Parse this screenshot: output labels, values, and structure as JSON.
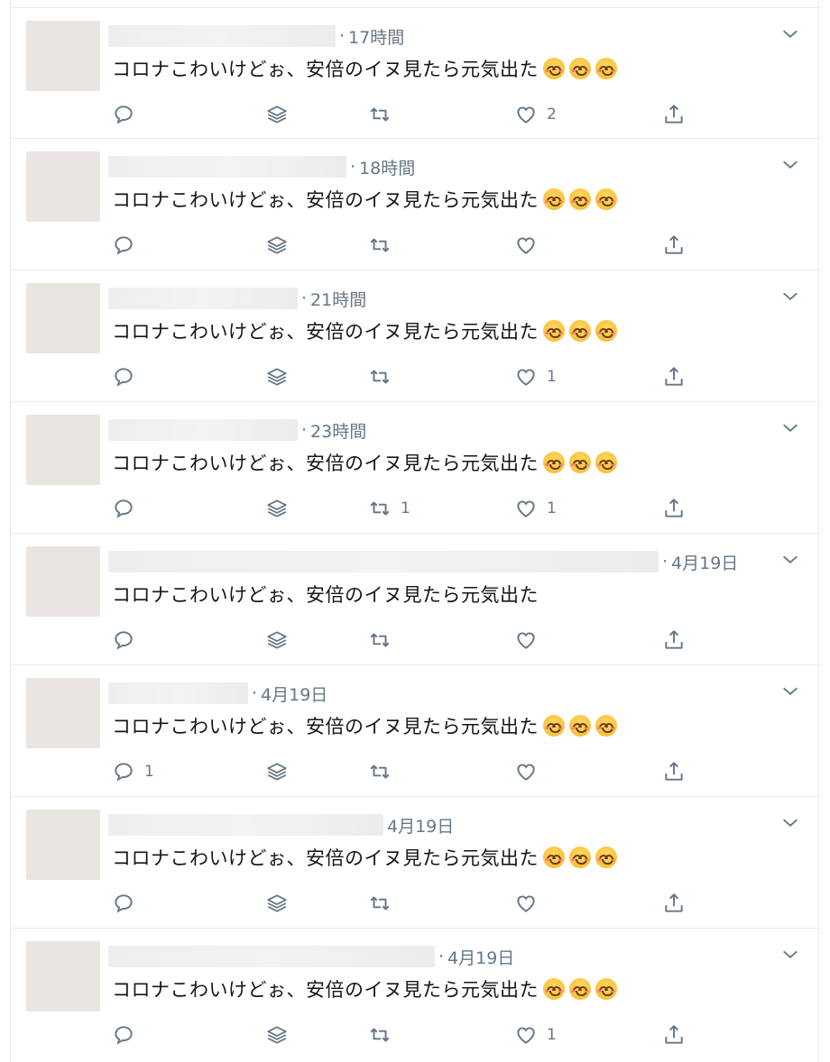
{
  "icons": {
    "reply": "reply-icon",
    "layers": "layers-icon",
    "retweet": "retweet-icon",
    "like": "heart-icon",
    "share": "share-icon",
    "menu": "chevron-down-icon"
  },
  "colors": {
    "icon": "#657786",
    "border": "#e6ecf0",
    "text": "#14171a"
  },
  "tweets": [
    {
      "time": "17時間",
      "text": "コロナこわいけどぉ、安倍のイヌ見たら元気出た",
      "emoji_count": 3,
      "replies": "",
      "retweets": "",
      "likes": "2"
    },
    {
      "time": "18時間",
      "text": "コロナこわいけどぉ、安倍のイヌ見たら元気出た",
      "emoji_count": 3,
      "replies": "",
      "retweets": "",
      "likes": ""
    },
    {
      "time": "21時間",
      "text": "コロナこわいけどぉ、安倍のイヌ見たら元気出た",
      "emoji_count": 3,
      "replies": "",
      "retweets": "",
      "likes": "1"
    },
    {
      "time": "23時間",
      "text": "コロナこわいけどぉ、安倍のイヌ見たら元気出た",
      "emoji_count": 3,
      "replies": "",
      "retweets": "1",
      "likes": "1"
    },
    {
      "time": "4月19日",
      "text": "コロナこわいけどぉ、安倍のイヌ見たら元気出た",
      "emoji_count": 0,
      "replies": "",
      "retweets": "",
      "likes": ""
    },
    {
      "time": "4月19日",
      "text": "コロナこわいけどぉ、安倍のイヌ見たら元気出た",
      "emoji_count": 3,
      "replies": "1",
      "retweets": "",
      "likes": ""
    },
    {
      "time": "4月19日",
      "text": "コロナこわいけどぉ、安倍のイヌ見たら元気出た",
      "emoji_count": 3,
      "replies": "",
      "retweets": "",
      "likes": ""
    },
    {
      "time": "4月19日",
      "text": "コロナこわいけどぉ、安倍のイヌ見たら元気出た",
      "emoji_count": 3,
      "replies": "",
      "retweets": "",
      "likes": "1"
    }
  ]
}
